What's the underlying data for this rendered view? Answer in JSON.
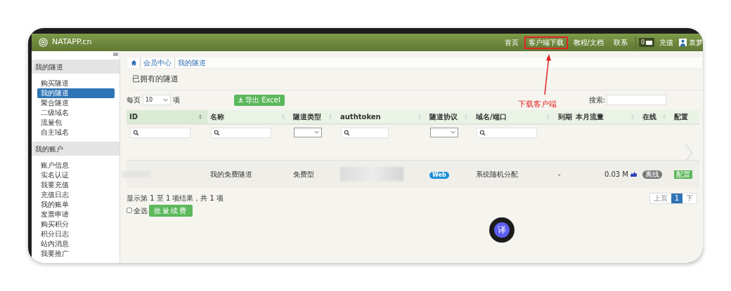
{
  "header": {
    "logo_text": "NATAPP.cn",
    "nav": [
      {
        "label": "首页",
        "selected": false
      },
      {
        "label": "客户端下载",
        "selected": true
      },
      {
        "label": "教程/文档",
        "selected": false
      },
      {
        "label": "联系",
        "selected": false
      }
    ],
    "mail_count": "0",
    "recharge": "充值",
    "user": "袁梦"
  },
  "annotation": {
    "text": "下载客户端"
  },
  "sidebar": {
    "sections": [
      {
        "title": "我的隧道",
        "items": [
          {
            "label": "购买隧道",
            "selected": false
          },
          {
            "label": "我的隧道",
            "selected": true
          },
          {
            "label": "聚合隧道",
            "selected": false
          },
          {
            "label": "二级域名",
            "selected": false
          },
          {
            "label": "流量包",
            "selected": false
          },
          {
            "label": "自主域名",
            "selected": false
          }
        ]
      },
      {
        "title": "我的账户",
        "items": [
          {
            "label": "账户信息",
            "selected": false
          },
          {
            "label": "实名认证",
            "selected": false
          },
          {
            "label": "我要充值",
            "selected": false
          },
          {
            "label": "充值日志",
            "selected": false
          },
          {
            "label": "我的账单",
            "selected": false
          },
          {
            "label": "发票申请",
            "selected": false
          },
          {
            "label": "购买积分",
            "selected": false
          },
          {
            "label": "积分日志",
            "selected": false
          },
          {
            "label": "站内消息",
            "selected": false
          },
          {
            "label": "我要推广",
            "selected": false
          }
        ]
      }
    ]
  },
  "breadcrumb": [
    "会员中心",
    "我的隧道"
  ],
  "page_title": "已拥有的隧道",
  "controls": {
    "per_page_label": "每页",
    "per_page_value": "10",
    "per_page_unit": "项",
    "export_button": "导出 Excel",
    "search_label": "搜索:"
  },
  "table": {
    "columns": [
      {
        "label": "ID",
        "kind": "search"
      },
      {
        "label": "名称",
        "kind": "search"
      },
      {
        "label": "隧道类型",
        "kind": "select"
      },
      {
        "label": "authtoken",
        "kind": "search"
      },
      {
        "label": "隧道协议",
        "kind": "select"
      },
      {
        "label": "域名/端口",
        "kind": "search"
      },
      {
        "label": "到期",
        "kind": "plain"
      },
      {
        "label": "本月流量",
        "kind": "plain"
      },
      {
        "label": "在线",
        "kind": "plain"
      },
      {
        "label": "配置",
        "kind": "plain"
      }
    ],
    "rows": [
      {
        "name": "我的免费隧道",
        "type": "免费型",
        "protocol": "Web",
        "domain": "系统随机分配",
        "expiry": "-",
        "traffic": "0.03 M",
        "online": false,
        "status": "离线",
        "config": "配置"
      }
    ]
  },
  "footer": {
    "summary": "显示第 1 至 1 项结果，共 1 项",
    "select_all": {
      "label": "全选",
      "checked": false
    },
    "batch_button": "批量续费",
    "pagination": [
      {
        "label": "上页",
        "selected": false
      },
      {
        "label": "1",
        "selected": true
      },
      {
        "label": "下",
        "selected": false
      }
    ]
  },
  "translate_button": "译"
}
